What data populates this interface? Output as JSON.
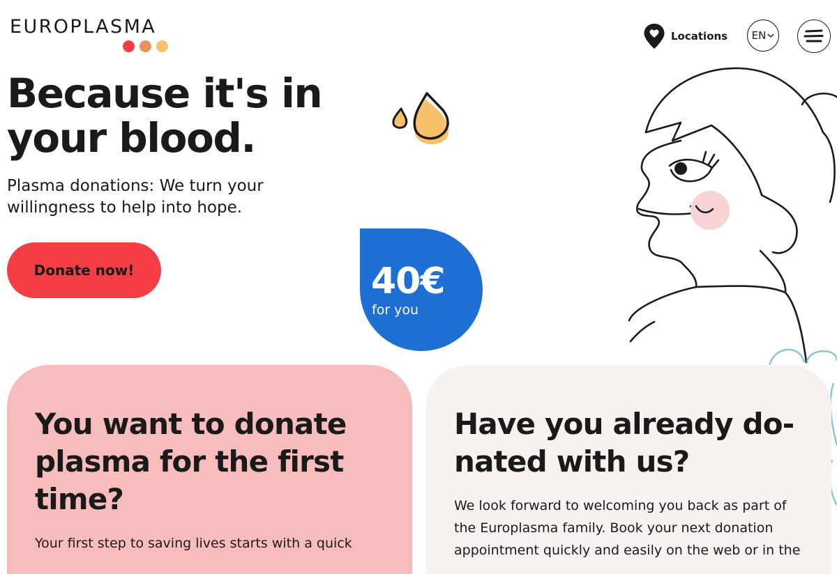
{
  "brand": {
    "name": "EUROPLASMA",
    "dot_colors": [
      "#f43e43",
      "#e8935c",
      "#f7c06b"
    ]
  },
  "header": {
    "locations_label": "Locations",
    "locations_icon": "map-pin-icon",
    "language": "EN",
    "menu_icon": "hamburger-menu-icon"
  },
  "hero": {
    "title": "Because it's in your blood.",
    "subtitle": "Plasma donations: We turn your willingness to help into hope.",
    "cta_label": "Donate now!"
  },
  "badge": {
    "amount": "40€",
    "caption": "for you"
  },
  "cards": [
    {
      "title": "You want to donate plasma for the first time?",
      "text": "Your first step to saving lives starts with a quick"
    },
    {
      "title": "Have you already do-nated with us?",
      "text": "We look forward to welcoming you back as part of the Europlasma family. Book your next donation appointment quickly and easily on the web or in the"
    }
  ],
  "colors": {
    "accent_red": "#f43e43",
    "badge_blue": "#1e6fd4",
    "card_pink": "#f9bcbc",
    "card_beige": "#f7f2ef",
    "drop_orange": "#f7c06b",
    "cheek_pink": "#f7d4d4",
    "swirl_blue": "#8cc6d6"
  }
}
